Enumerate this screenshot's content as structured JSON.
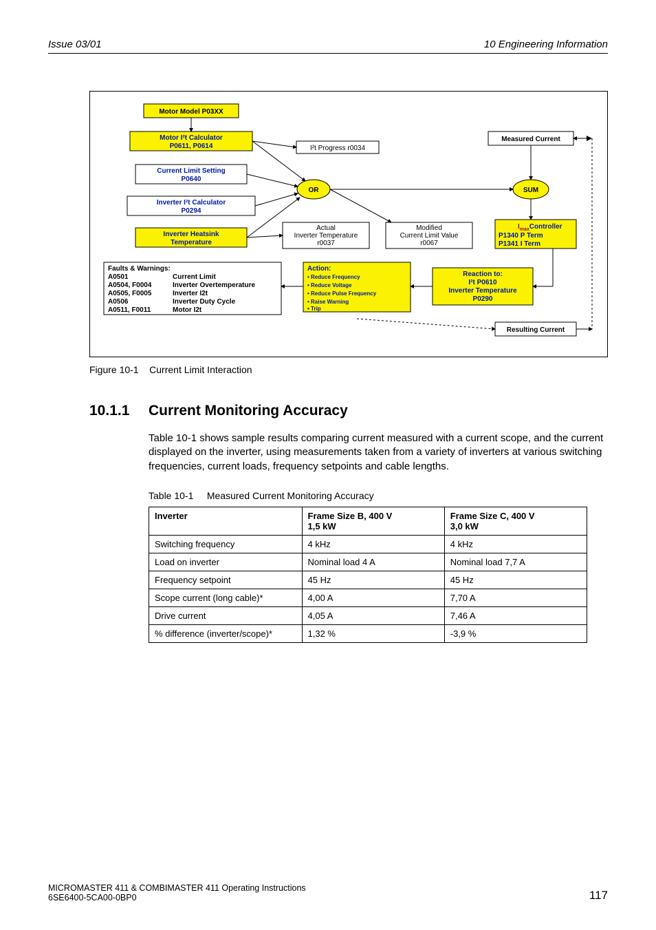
{
  "header": {
    "left": "Issue 03/01",
    "right": "10  Engineering Information"
  },
  "diagram": {
    "motor_model": "Motor Model P03XX",
    "motor_i2t": {
      "l1": "Motor I²t Calculator",
      "l2": "P0611, P0614"
    },
    "cur_lim_set": {
      "l1": "Current Limit Setting",
      "l2": "P0640"
    },
    "inv_i2t": {
      "l1": "Inverter I²t Calculator",
      "l2": "P0294"
    },
    "inv_hs": {
      "l1": "Inverter Heatsink",
      "l2": "Temperature"
    },
    "progress": "I²t Progress r0034",
    "actual": {
      "l1": "Actual",
      "l2": "Inverter Temperature",
      "l3": "r0037"
    },
    "modified": {
      "l1": "Modified",
      "l2": "Current Limit Value",
      "l3": "r0067"
    },
    "measured": "Measured Current",
    "sum": "SUM",
    "or": "OR",
    "ctrl": {
      "l1a": "I",
      "l1b": "max",
      "l1c": "Controller",
      "l2": "P1340  P Term",
      "l3": "P1341  I Term"
    },
    "reaction": {
      "title": "Reaction to:",
      "r1": "I²t P0610",
      "r2": "Inverter Temperature",
      "r3": "P0290"
    },
    "action": {
      "title": "Action:",
      "a1": "• Reduce Frequency",
      "a2": "• Reduce Voltage",
      "a3": "• Reduce Pulse Frequency",
      "a4": "• Raise Warning",
      "a5": "• Trip"
    },
    "faults": {
      "title": "Faults & Warnings:",
      "rows": [
        {
          "c": "A0501",
          "l": "Current Limit"
        },
        {
          "c": "A0504, F0004",
          "l": "Inverter Overtemperature"
        },
        {
          "c": "A0505, F0005",
          "l": "Inverter I2t"
        },
        {
          "c": "A0506",
          "l": "Inverter Duty Cycle"
        },
        {
          "c": "A0511, F0011",
          "l": "Motor I2t"
        }
      ]
    },
    "resulting": "Resulting Current"
  },
  "fig_caption": {
    "num": "Figure 10-1",
    "title": "Current Limit Interaction"
  },
  "section": {
    "num": "10.1.1",
    "title": "Current Monitoring Accuracy"
  },
  "body": "Table 10-1 shows sample results comparing current measured with a current scope, and the current displayed on the inverter, using measurements taken from a variety of inverters at various switching frequencies, current loads, frequency setpoints and cable lengths.",
  "table_caption": {
    "num": "Table 10-1",
    "title": "Measured Current Monitoring Accuracy"
  },
  "table": {
    "headers": [
      "Inverter",
      "Frame Size B, 400 V\n1,5 kW",
      "Frame Size C, 400 V\n3,0 kW"
    ],
    "rows": [
      [
        "Switching frequency",
        "4 kHz",
        "4 kHz"
      ],
      [
        "Load on inverter",
        "Nominal load 4 A",
        "Nominal load 7,7 A"
      ],
      [
        "Frequency setpoint",
        "45 Hz",
        "45 Hz"
      ],
      [
        "Scope current (long cable)*",
        "4,00 A",
        "7,70 A"
      ],
      [
        "Drive current",
        "4,05 A",
        "7,46 A"
      ],
      [
        "% difference (inverter/scope)*",
        "1,32 %",
        "-3,9 %"
      ]
    ]
  },
  "footer": {
    "l1": "MICROMASTER 411 & COMBIMASTER 411    Operating Instructions",
    "l2": "6SE6400-5CA00-0BP0",
    "page": "117"
  }
}
